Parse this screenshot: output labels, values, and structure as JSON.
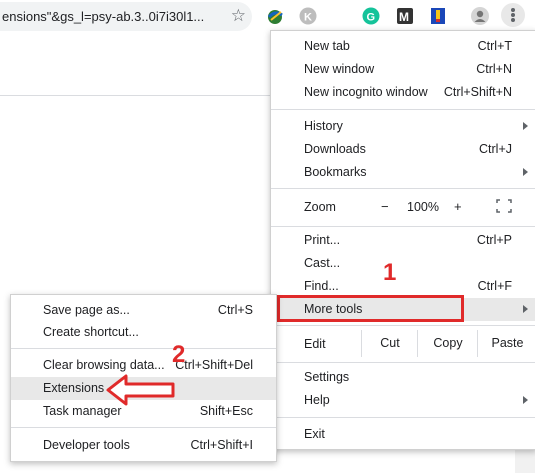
{
  "toolbar": {
    "address_text": "ensions\"&gs_l=psy-ab.3..0i7i30l1..."
  },
  "main_menu": {
    "items": [
      {
        "label": "New tab",
        "shortcut": "Ctrl+T"
      },
      {
        "label": "New window",
        "shortcut": "Ctrl+N"
      },
      {
        "label": "New incognito window",
        "shortcut": "Ctrl+Shift+N"
      },
      {
        "label": "History",
        "shortcut": ""
      },
      {
        "label": "Downloads",
        "shortcut": "Ctrl+J"
      },
      {
        "label": "Bookmarks",
        "shortcut": ""
      },
      {
        "label": "Print...",
        "shortcut": "Ctrl+P"
      },
      {
        "label": "Cast...",
        "shortcut": ""
      },
      {
        "label": "Find...",
        "shortcut": "Ctrl+F"
      },
      {
        "label": "More tools",
        "shortcut": ""
      },
      {
        "label": "Settings",
        "shortcut": ""
      },
      {
        "label": "Help",
        "shortcut": ""
      },
      {
        "label": "Exit",
        "shortcut": ""
      }
    ],
    "zoom": {
      "label": "Zoom",
      "minus": "−",
      "value": "100%",
      "plus": "+"
    },
    "edit": {
      "label": "Edit",
      "cut": "Cut",
      "copy": "Copy",
      "paste": "Paste"
    }
  },
  "sub_menu": {
    "items": [
      {
        "label": "Save page as...",
        "shortcut": "Ctrl+S"
      },
      {
        "label": "Create shortcut...",
        "shortcut": ""
      },
      {
        "label": "Clear browsing data...",
        "shortcut": "Ctrl+Shift+Del"
      },
      {
        "label": "Extensions",
        "shortcut": ""
      },
      {
        "label": "Task manager",
        "shortcut": "Shift+Esc"
      },
      {
        "label": "Developer tools",
        "shortcut": "Ctrl+Shift+I"
      }
    ]
  },
  "annotations": {
    "step1": "1",
    "step2": "2",
    "color": "#e02a2a"
  },
  "icons": [
    "star-icon",
    "extension-icons",
    "profile-icon",
    "menu-dots-icon",
    "fullscreen-icon",
    "submenu-arrow-icon"
  ]
}
